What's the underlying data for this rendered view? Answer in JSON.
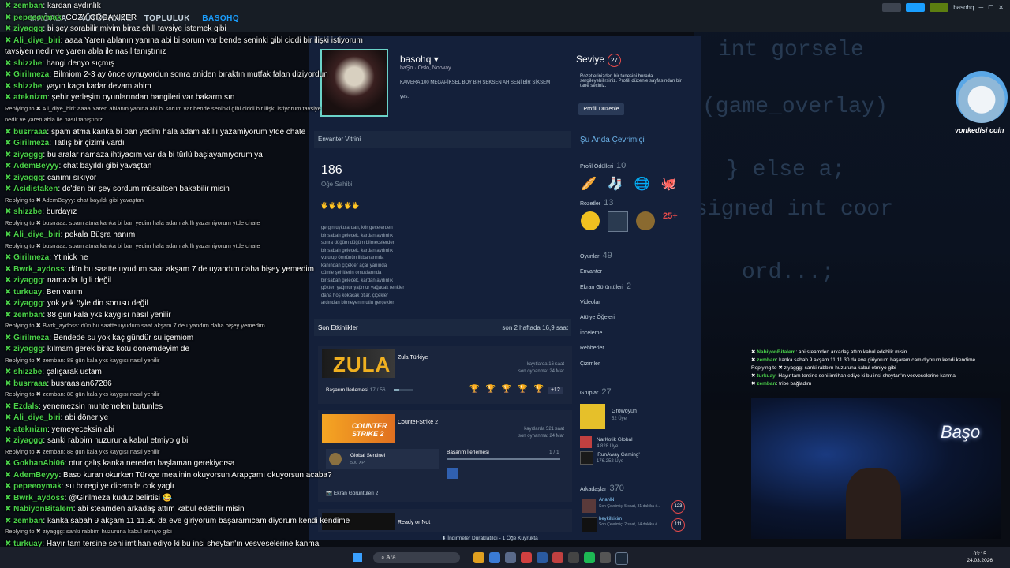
{
  "steam_nav": {
    "items": [
      "MAĞAZA",
      "KÜTÜPHANE",
      "TOPLULUK",
      "BASOHQ"
    ],
    "user": "basohq"
  },
  "profile": {
    "name": "basohq",
    "realname": "baŞo",
    "location": "Oslo, Norway",
    "bio": "KAMERA 100 MEGAPİKSEL BOY BİR SEKSEN AH SENİ BİR SİKSEM",
    "bio2": "yes.",
    "level_label": "Seviye",
    "level": "27",
    "level_text": "Rozetlerinizden bir tanesini burada sergileyebilirsiniz. Profili düzenle sayfasından bir tane seçiniz.",
    "edit_button": "Profili Düzenle"
  },
  "inventory": {
    "title": "Envanter Vitrini",
    "count": "186",
    "count_label": "Öğe Sahibi"
  },
  "poem": [
    "gergin uykulardan, kör gecelerden",
    "bir sabah gelecek, kardan aydınlık",
    "sonra düğüm düğüm bilmecelerden",
    "bir sabah gelecek, kardan aydınlık",
    "vurulup ömrünün ilkbaharında",
    "kanından çiçekler açar yanında",
    "cümle şehitlerin omuzlarında",
    "bir sabah gelecek, kardan aydınlık",
    "gökten yağmur yağmur yağacak renkler",
    "daha hoş kokacak otlar, çiçekler",
    "ardından bitmeyen mutlu gerçekler"
  ],
  "recent": {
    "title": "Son Etkinlikler",
    "summary": "son 2 haftada 16,9 saat"
  },
  "games": [
    {
      "name": "Zula Türkiye",
      "hours": "kayıtlarda 16 saat",
      "last": "son oynanma: 24 Mar",
      "ach": "Başarım İlerlemesi",
      "ach_count": "17 / 56",
      "extra": "+12"
    },
    {
      "name": "Counter-Strike 2",
      "hours": "kayıtlarda 521 saat",
      "last": "son oynanma: 24 Mar",
      "badge": "Global Sentinel",
      "xp": "500 XP",
      "ach": "Başarım İlerlemesi",
      "ach_count": "1 / 1",
      "shots": "Ekran Görüntüleri 2"
    },
    {
      "name": "Ready or Not"
    }
  ],
  "sidebar": {
    "online": "Şu Anda Çevrimiçi",
    "awards": "Profil Ödülleri",
    "awards_n": "10",
    "badges": "Rozetler",
    "badges_n": "13",
    "links": [
      "Oyunlar",
      "Envanter",
      "Ekran Görüntüleri",
      "Videolar",
      "Atölye Öğeleri",
      "İnceleme",
      "Rehberler",
      "Çizimler"
    ],
    "games_n": "49",
    "shots_n": "2",
    "groups": "Gruplar",
    "groups_n": "27",
    "group_list": [
      {
        "name": "Growoyun",
        "members": "52 Üye"
      },
      {
        "name": "NarKotik Global",
        "members": "4.828 Üye"
      },
      {
        "name": "'RunAway Gaming'",
        "members": "176.252 Üye"
      }
    ],
    "friends": "Arkadaşlar",
    "friends_n": "370",
    "friend_list": [
      {
        "name": "AnaNN",
        "status": "Son Çevrimiçi 5 saat, 31 dakika ö...",
        "lvl": "123"
      },
      {
        "name": "heykilkikim",
        "status": "Son Çevrimiçi 2 saat, 14 dakika ö...",
        "lvl": "111"
      }
    ]
  },
  "chat": [
    {
      "u": "zemban",
      "t": "kardan aydınlık"
    },
    {
      "u": "pepeeoymak",
      "t": "COZY ORGANIZER"
    },
    {
      "u": "ziyaggg",
      "t": "bi şey sorabilir miyim biraz chill tavsiye istemek gibi"
    },
    {
      "u": "Ali_diye_biri",
      "t": "aaaa Yaren ablanın yanına abi bi sorum var bende seninki gibi ciddi bir ilişki istiyorum"
    },
    {
      "u": "",
      "t": "tavsiyen nedir ve yaren abla ile nasıl tanıştınız"
    },
    {
      "u": "shizzbe",
      "t": "hangi denyo sıçmış"
    },
    {
      "u": "Girilmeza",
      "t": "Bilmiom 2-3 ay önce oynuyordun sonra aniden bıraktın mutfak falan diziyordun"
    },
    {
      "u": "shizzbe",
      "t": "yayın kaça kadar devam abim"
    },
    {
      "u": "ateknizm",
      "t": "şehir yerleşim oyunlarından hangileri var bakarmısın"
    },
    {
      "r": "Replying to ✖ Ali_diye_biri: aaaa Yaren ablanın yanına abi bi sorum var bende seninki gibi ciddi bir ilişki istiyorum tavsiye"
    },
    {
      "r": "nedir ve yaren abla ile nasıl tanıştınız"
    },
    {
      "u": "busrraaa",
      "t": "spam atma kanka bi ban yedim hala adam akıllı yazamiyorum ytde chate"
    },
    {
      "u": "Girilmeza",
      "t": "Tatlış bir çizimi vardı"
    },
    {
      "u": "ziyaggg",
      "t": "bu aralar namaza ihtiyacım var da bi türlü başlayamıyorum ya"
    },
    {
      "u": "AdemBeyyy",
      "t": "chat bayıldı gibi yavaştan"
    },
    {
      "u": "ziyaggg",
      "t": "canımı sıkıyor"
    },
    {
      "u": "Asidistaken",
      "t": "dc'den bir şey sordum müsaitsen bakabilir misin"
    },
    {
      "r": "Replying to ✖ AdemBeyyy: chat bayıldı gibi yavaştan"
    },
    {
      "u": "shizzbe",
      "t": "burdayız"
    },
    {
      "r": "Replying to ✖ busrraaa: spam atma kanka bi ban yedim hala adam akıllı yazamiyorum ytde chate"
    },
    {
      "u": "Ali_diye_biri",
      "t": "pekala Büşra hanım"
    },
    {
      "r": "Replying to ✖ busrraaa: spam atma kanka bi ban yedim hala adam akıllı yazamiyorum ytde chate"
    },
    {
      "u": "Girilmeza",
      "t": "Yt nick ne"
    },
    {
      "u": "Bwrk_aydoss",
      "t": "dün bu saatte uyudum saat akşam 7 de uyandım daha bişey yemedim"
    },
    {
      "u": "ziyaggg",
      "t": "namazla ilgili değil"
    },
    {
      "u": "turkuay",
      "t": "Ben varım"
    },
    {
      "u": "ziyaggg",
      "t": "yok yok öyle din sorusu değil"
    },
    {
      "u": "zemban",
      "t": "88 gün kala yks kaygısı nasıl yenilir"
    },
    {
      "r": "Replying to ✖ Bwrk_aydoss: dün bu saatte uyudum saat akşam 7 de uyandım daha bişey yemedim"
    },
    {
      "u": "Girilmeza",
      "t": "Bendede su yok kaç gündür su içemiom"
    },
    {
      "u": "ziyaggg",
      "t": "kılmam gerek biraz kötü dönemdeyim de"
    },
    {
      "r": "Replying to ✖ zemban: 88 gün kala yks kaygısı nasıl yenilir"
    },
    {
      "u": "shizzbe",
      "t": "çalışarak ustam"
    },
    {
      "u": "busrraaa",
      "t": "busraaslan67286"
    },
    {
      "r": "Replying to ✖ zemban: 88 gün kala yks kaygısı nasıl yenilir"
    },
    {
      "u": "Ezdals",
      "t": "yenemezsin muhtemelen butunles"
    },
    {
      "u": "Ali_diye_biri",
      "t": "abi döner ye"
    },
    {
      "u": "ateknizm",
      "t": "yemeyeceksin abi"
    },
    {
      "u": "ziyaggg",
      "t": "sanki rabbim huzuruna kabul etmiyo gibi"
    },
    {
      "r": "Replying to ✖ zemban: 88 gün kala yks kaygısı nasıl yenilir"
    },
    {
      "u": "GokhanAbi06",
      "t": "otur çalış kanka nereden başlaman gerekiyorsa"
    },
    {
      "u": "AdemBeyyy",
      "t": "Baso kuran okurken Türkçe mealinin okuyorsun Arapçamı okuyorsun acaba?"
    },
    {
      "u": "pepeeoymak",
      "t": "su boregi ye dicemde cok yaglı"
    },
    {
      "u": "Bwrk_aydoss",
      "t": "@Girilmeza kuduz belirtisi 😂"
    },
    {
      "u": "NabiyonBitalem",
      "t": "abi steamden arkadaş attım kabul edebilir misin"
    },
    {
      "u": "zemban",
      "t": "kanka sabah 9 akşam 11 11.30 da eve giriyorum başaramıcam diyorum kendi kendime"
    },
    {
      "r": "Replying to ✖ ziyaggg: sanki rabbim huzuruna kabul etmiyo gibi"
    },
    {
      "u": "turkuay",
      "t": "Hayır tam tersine seni imtihan ediyo ki bu insi sheytan'ın vesveselerine kanma"
    },
    {
      "u": "zemban",
      "t": "tribe bağladım"
    }
  ],
  "right_chat": [
    {
      "u": "NabiyonBitalem",
      "t": "abi steamden arkadaş attım kabul edebilir misin"
    },
    {
      "u": "zemban",
      "t": "kanka sabah 9 akşam 11 11.30 da eve giriyorum başaramıcam diyorum kendi kendime"
    },
    {
      "u": "",
      "t": "Replying to ✖ ziyaggg: sanki rabbim huzuruna kabul etmiyo gibi"
    },
    {
      "u": "turkuay",
      "t": "Hayır tam tersine seni imtihan ediyo ki bu insi sheytan'ın vesveselerine kanma"
    },
    {
      "u": "zemban",
      "t": "tribe bağladım"
    }
  ],
  "overlay": {
    "cat_label": "vonkedisi coin",
    "cam_text": "Başo"
  },
  "downloads": "İndirmeler Duraklatıldı - 1 Öğe Kuyrukta",
  "taskbar": {
    "search": "Ara",
    "time": "03:15",
    "date": "24.03.2026"
  }
}
